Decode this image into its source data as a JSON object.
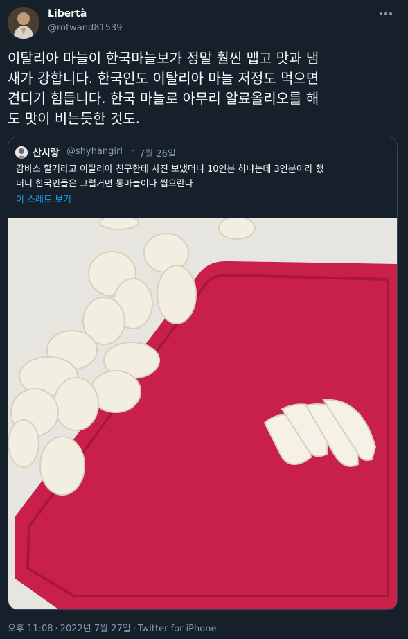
{
  "author": {
    "display_name": "Libertà",
    "handle": "@rotwand81539"
  },
  "tweet": {
    "text": "이탈리아 마늘이 한국마늘보가 정말 훨씬 맵고 맛과 냄\n새가 강합니다. 한국인도 이탈리아 마늘 저정도 먹으면\n견디기 힘듭니다. 한국 마늘로 아무리 알료올리오를 해\n도 맛이 비는듯한 것도."
  },
  "quoted_tweet": {
    "display_name": "산시랑",
    "handle": "@shyhangirl",
    "separator": "·",
    "date": "7월 26일",
    "text": "감바스 할거라고 이탈리아 친구한테 사진 보냈더니 10인분 하냐는데 3인분이라 했\n더니 한국인들은 그럴거면 통마늘이나 씹으란다",
    "thread_link": "이 스레드 보기"
  },
  "colors": {
    "background": "#15202b",
    "link": "#1d9bf0",
    "cutting_board": "#c8204a"
  },
  "footer": {
    "time": "오후 11:08",
    "separator1": "·",
    "date": "2022년 7월 27일",
    "separator2": "·",
    "source": "Twitter for iPhone"
  }
}
